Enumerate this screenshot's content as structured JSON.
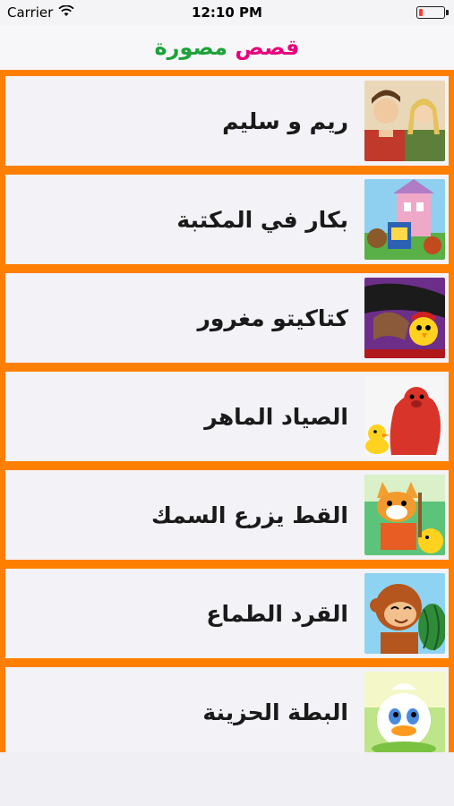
{
  "status": {
    "carrier": "Carrier",
    "time": "12:10 PM",
    "wifi_icon": "wifi-icon",
    "battery_icon": "battery-low-icon"
  },
  "header": {
    "title_word1": "قصص",
    "title_word2": "مصورة"
  },
  "colors": {
    "list_separator": "#ff7f00",
    "row_background": "#f2f2f7",
    "title_pink": "#e6007e",
    "title_green": "#1ea23a"
  },
  "stories": [
    {
      "title": "ريم و سليم",
      "thumb_icon": "story-thumbnail-rim-salim"
    },
    {
      "title": "بكار في المكتبة",
      "thumb_icon": "story-thumbnail-bakar-library"
    },
    {
      "title": "كتاكيتو مغرور",
      "thumb_icon": "story-thumbnail-katakito"
    },
    {
      "title": "الصياد الماهر",
      "thumb_icon": "story-thumbnail-fisherman-seal"
    },
    {
      "title": "القط يزرع السمك",
      "thumb_icon": "story-thumbnail-cat-fish"
    },
    {
      "title": "القرد الطماع",
      "thumb_icon": "story-thumbnail-greedy-monkey"
    },
    {
      "title": "البطة الحزينة",
      "thumb_icon": "story-thumbnail-sad-duck"
    }
  ]
}
